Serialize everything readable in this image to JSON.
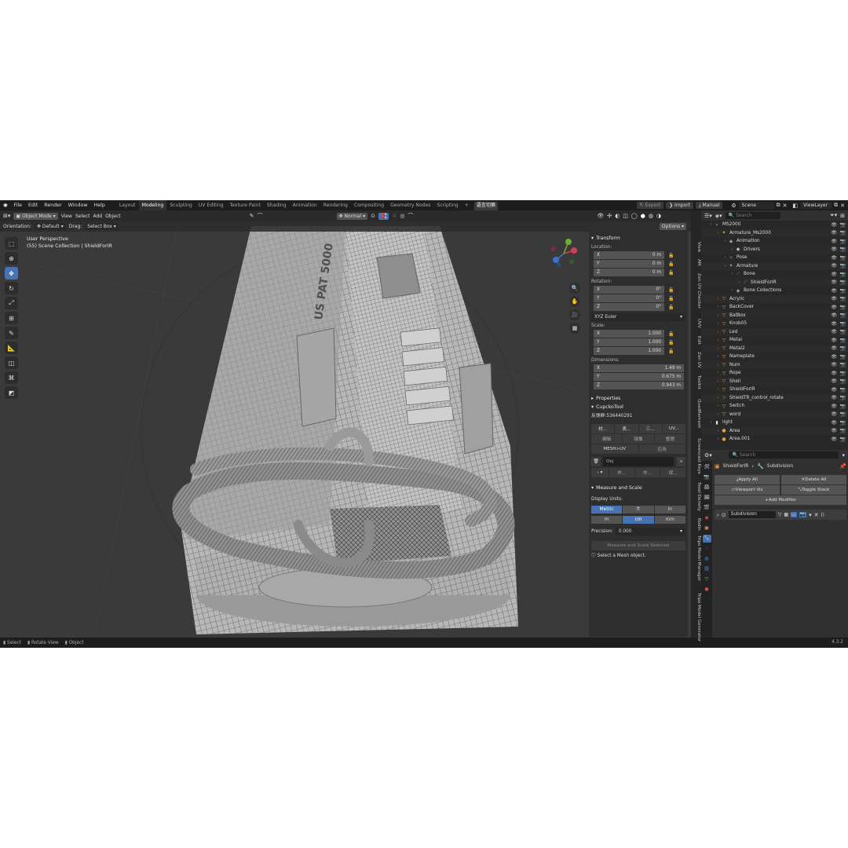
{
  "menu": [
    "File",
    "Edit",
    "Render",
    "Window",
    "Help"
  ],
  "workspaces": [
    "Layout",
    "Modeling",
    "Sculpting",
    "UV Editing",
    "Texture Paint",
    "Shading",
    "Animation",
    "Rendering",
    "Compositing",
    "Geometry Nodes",
    "Scripting"
  ],
  "workspace_active": "Modeling",
  "workspace_add": "+",
  "lang_button": "语言切换",
  "top_right": {
    "export": "Export",
    "import": "Import",
    "manual": "Manual",
    "scene": "Scene",
    "view_layer": "ViewLayer"
  },
  "viewport_header": {
    "mode": "Object Mode",
    "view": "View",
    "select": "Select",
    "add": "Add",
    "object": "Object",
    "transform": "Normal",
    "orientation_label": "Orientation:",
    "orientation_value": "Default",
    "drag_label": "Drag:",
    "drag_value": "Select Box",
    "options": "Options"
  },
  "viewport_info": {
    "line1": "User Perspective",
    "line2": "(55) Scene Collection | ShieldForIR"
  },
  "model_text": {
    "imprint": "US PAT 5000"
  },
  "npanel": {
    "transform_title": "Transform",
    "location_label": "Location:",
    "location": [
      {
        "axis": "X",
        "value": "0 m"
      },
      {
        "axis": "Y",
        "value": "0 m"
      },
      {
        "axis": "Z",
        "value": "0 m"
      }
    ],
    "rotation_label": "Rotation:",
    "rotation": [
      {
        "axis": "X",
        "value": "0°"
      },
      {
        "axis": "Y",
        "value": "0°"
      },
      {
        "axis": "Z",
        "value": "0°"
      }
    ],
    "rotation_mode": "XYZ Euler",
    "scale_label": "Scale:",
    "scale": [
      {
        "axis": "X",
        "value": "1.000"
      },
      {
        "axis": "Y",
        "value": "1.000"
      },
      {
        "axis": "Z",
        "value": "1.000"
      }
    ],
    "dimensions_label": "Dimensions:",
    "dimensions": [
      {
        "axis": "X",
        "value": "1.49 m"
      },
      {
        "axis": "Y",
        "value": "0.675 m"
      },
      {
        "axis": "Z",
        "value": "0.943 m"
      }
    ],
    "properties_title": "Properties",
    "cupcko_title": "CupckoTool",
    "cupcko_id": "反馈群:536440291",
    "cupcko_row1": [
      "材...",
      "表...",
      "三...",
      "UV..."
    ],
    "cupcko_row2": [
      "编辑",
      "镜像",
      "整理"
    ],
    "mesh_uv": "MESH>UV",
    "apply": "应用",
    "obj_label": "Obj",
    "cupcko_row4": [
      "作...",
      "作...",
      "保..."
    ],
    "measure_title": "Measure and Scale",
    "display_units_label": "Display Units:",
    "units_row1": [
      "Metric",
      "ft",
      "in"
    ],
    "units_row2": [
      "m",
      "cm",
      "mm"
    ],
    "precision_label": "Precision:",
    "precision_value": "0.000",
    "measure_button": "Measure and Scale Selected",
    "hint": "Select a Mesh object."
  },
  "side_tabs": [
    "View",
    "AM",
    "Zen UV Checker",
    "UVV",
    "Edit",
    "Zen UV",
    "Toolkit",
    "QuadRemesh",
    "Screencast Keys",
    "Texel Density",
    "Rodin",
    "Tripo Model Manager",
    "Tripo Model Generator"
  ],
  "outliner": {
    "search_placeholder": "Search",
    "rows": [
      {
        "indent": 1,
        "label": "MS2000",
        "icon": "▿",
        "color": "#e0a040"
      },
      {
        "indent": 2,
        "label": "Armature_Ms2000",
        "icon": "✦",
        "color": "#e0a040"
      },
      {
        "indent": 3,
        "label": "Animation",
        "icon": "◈",
        "color": "#c0c0c0"
      },
      {
        "indent": 4,
        "label": "Drivers",
        "icon": "◆",
        "color": "#c0c0c0"
      },
      {
        "indent": 3,
        "label": "Pose",
        "icon": "✧",
        "color": "#70c070"
      },
      {
        "indent": 3,
        "label": "Armature",
        "icon": "✦",
        "color": "#70c070"
      },
      {
        "indent": 4,
        "label": "Bone",
        "icon": "⟋",
        "color": "#70c070"
      },
      {
        "indent": 5,
        "label": "ShieldForIR",
        "icon": "⟋",
        "color": "#70c070"
      },
      {
        "indent": 4,
        "label": "Bone Collections",
        "icon": "◈",
        "color": "#c0c0c0"
      },
      {
        "indent": 2,
        "label": "Acrylic",
        "icon": "▽",
        "color": "#e09040"
      },
      {
        "indent": 2,
        "label": "BackCover",
        "icon": "▽",
        "color": "#e09040"
      },
      {
        "indent": 2,
        "label": "BatBox",
        "icon": "▽",
        "color": "#e09040"
      },
      {
        "indent": 2,
        "label": "Knob05",
        "icon": "▽",
        "color": "#e09040"
      },
      {
        "indent": 2,
        "label": "Led",
        "icon": "▽",
        "color": "#e09040"
      },
      {
        "indent": 2,
        "label": "Metal",
        "icon": "▽",
        "color": "#e09040"
      },
      {
        "indent": 2,
        "label": "Metal2",
        "icon": "▽",
        "color": "#e09040"
      },
      {
        "indent": 2,
        "label": "Nameplate",
        "icon": "▽",
        "color": "#e09040"
      },
      {
        "indent": 2,
        "label": "Num",
        "icon": "▽",
        "color": "#e09040"
      },
      {
        "indent": 2,
        "label": "Rope",
        "icon": "▽",
        "color": "#e09040"
      },
      {
        "indent": 2,
        "label": "Shell",
        "icon": "▽",
        "color": "#e09040"
      },
      {
        "indent": 2,
        "label": "ShieldForIR",
        "icon": "▽",
        "color": "#e09040"
      },
      {
        "indent": 2,
        "label": "ShieldTR_control_rotate",
        "icon": "⊃",
        "color": "#e09040"
      },
      {
        "indent": 2,
        "label": "Switch",
        "icon": "▽",
        "color": "#e09040"
      },
      {
        "indent": 2,
        "label": "word",
        "icon": "▽",
        "color": "#e09040"
      },
      {
        "indent": 1,
        "label": "light",
        "icon": "▮",
        "color": "#dddddd"
      },
      {
        "indent": 2,
        "label": "Area",
        "icon": "●",
        "color": "#e0a040"
      },
      {
        "indent": 2,
        "label": "Area.001",
        "icon": "●",
        "color": "#e0a040"
      }
    ]
  },
  "properties": {
    "search_placeholder": "Search",
    "object": "ShieldForIR",
    "modifier_tab": "Subdivision",
    "apply_all": "Apply All",
    "delete_all": "Delete All",
    "viewport_vis": "Viewport Vis",
    "toggle_stack": "Toggle Stack",
    "add_modifier": "Add Modifier",
    "modifier_name": "Subdivision"
  },
  "status": {
    "select": "Select",
    "rotate": "Rotate View",
    "object": "Object",
    "version": "4.3.2"
  },
  "colors": {
    "accent": "#4772b3",
    "header": "#1d1d1d",
    "panel": "#303030",
    "viewport": "#3a3a3a"
  }
}
